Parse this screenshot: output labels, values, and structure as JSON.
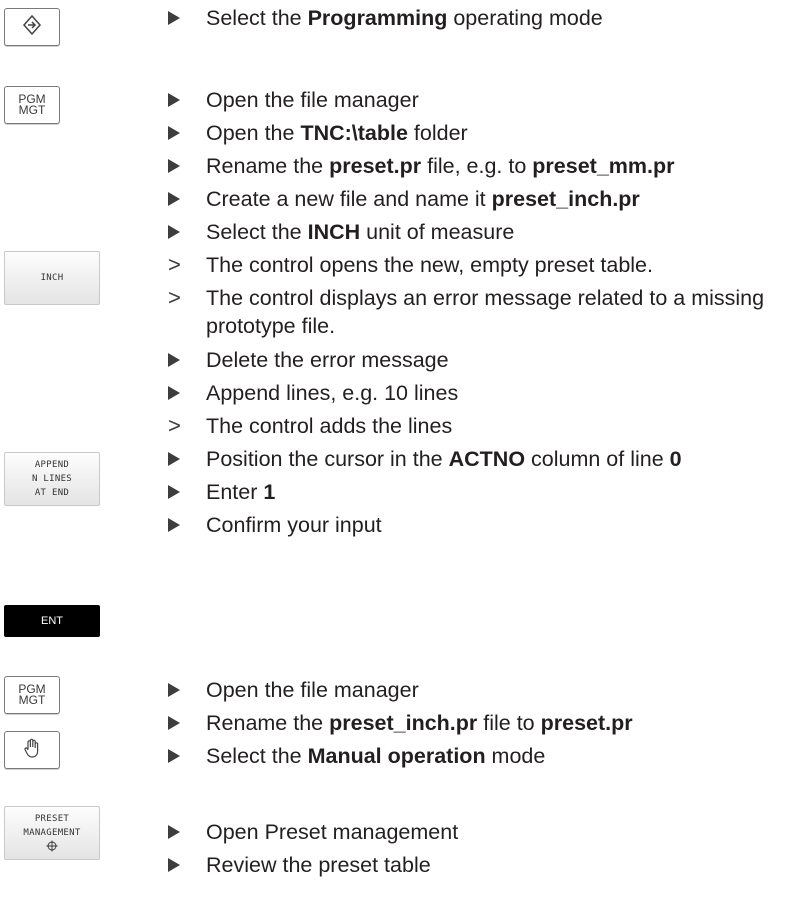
{
  "keys": {
    "programming": {
      "icon": "programming-mode-icon"
    },
    "pgm_mgt_1": {
      "label": "PGM\nMGT"
    },
    "inch": {
      "label": "INCH"
    },
    "append": {
      "label": "APPEND\nN LINES\nAT END"
    },
    "ent": {
      "label": "ENT"
    },
    "pgm_mgt_2": {
      "label": "PGM\nMGT"
    },
    "manual": {
      "icon": "hand-icon"
    },
    "preset": {
      "label": "PRESET\nMANAGEMENT",
      "icon": "crosshair-icon"
    }
  },
  "steps": [
    {
      "marker": "triangle",
      "parts": [
        "Select the ",
        "Programming",
        " operating mode"
      ]
    },
    {
      "marker": "triangle",
      "parts": [
        "Open the file manager"
      ]
    },
    {
      "marker": "triangle",
      "parts": [
        "Open the ",
        "TNC:\\table",
        " folder"
      ]
    },
    {
      "marker": "triangle",
      "parts": [
        "Rename the ",
        "preset.pr",
        " file, e.g. to ",
        "preset_mm.pr"
      ]
    },
    {
      "marker": "triangle",
      "parts": [
        "Create a new file and name it ",
        "preset_inch.pr"
      ]
    },
    {
      "marker": "triangle",
      "parts": [
        "Select the ",
        "INCH",
        " unit of measure"
      ]
    },
    {
      "marker": "result",
      "parts": [
        "The control opens the new, empty preset table."
      ]
    },
    {
      "marker": "result",
      "parts": [
        "The control displays an error message related to a missing prototype file."
      ]
    },
    {
      "marker": "triangle",
      "parts": [
        "Delete the error message"
      ]
    },
    {
      "marker": "triangle",
      "parts": [
        "Append lines, e.g. 10 lines"
      ]
    },
    {
      "marker": "result",
      "parts": [
        "The control adds the lines"
      ]
    },
    {
      "marker": "triangle",
      "parts": [
        "Position the cursor in the ",
        "ACTNO",
        " column of line ",
        "0"
      ]
    },
    {
      "marker": "triangle",
      "parts": [
        "Enter ",
        "1"
      ]
    },
    {
      "marker": "triangle",
      "parts": [
        "Confirm your input"
      ]
    },
    {
      "marker": "triangle",
      "parts": [
        "Open the file manager"
      ]
    },
    {
      "marker": "triangle",
      "parts": [
        "Rename the ",
        "preset_inch.pr",
        " file to ",
        "preset.pr"
      ]
    },
    {
      "marker": "triangle",
      "parts": [
        "Select the ",
        "Manual operation",
        " mode"
      ]
    },
    {
      "marker": "triangle",
      "parts": [
        "Open Preset management"
      ]
    },
    {
      "marker": "triangle",
      "parts": [
        "Review the preset table"
      ]
    }
  ]
}
